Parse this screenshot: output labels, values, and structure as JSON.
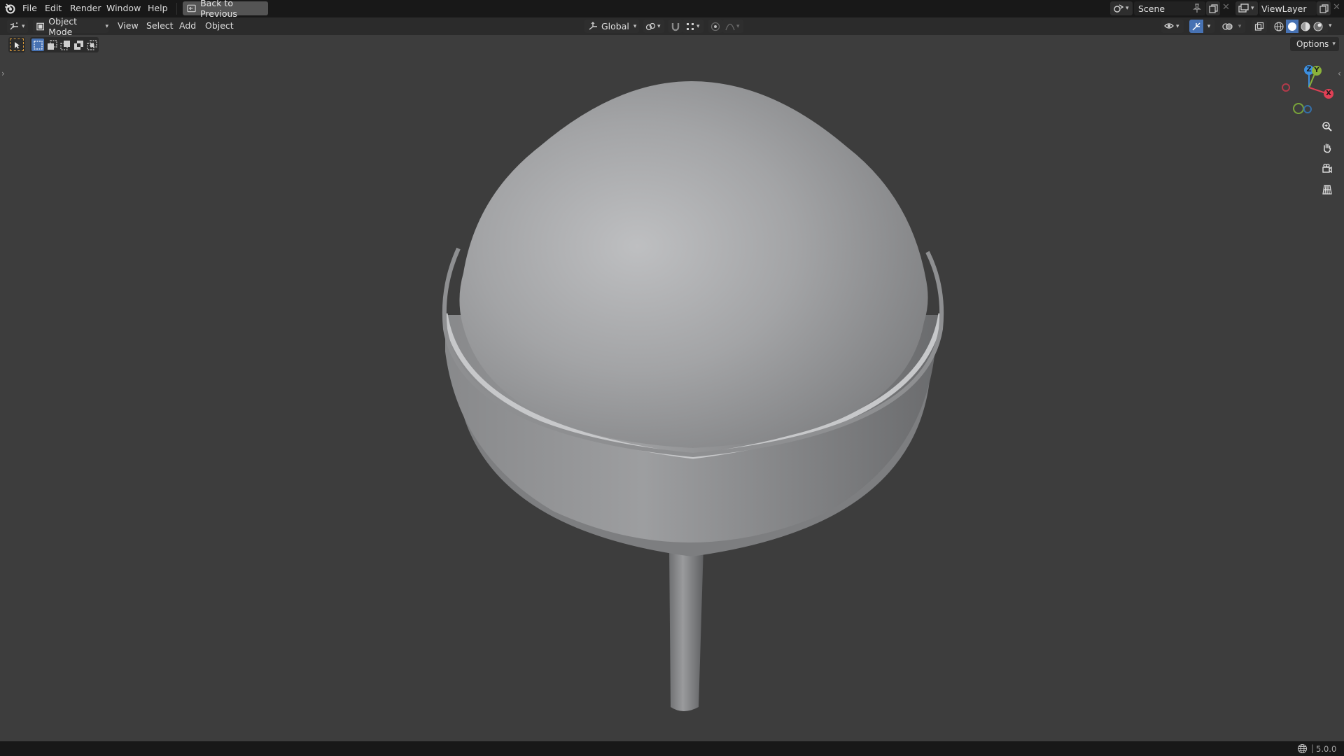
{
  "menu": {
    "file": "File",
    "edit": "Edit",
    "render": "Render",
    "window": "Window",
    "help": "Help",
    "back_to_previous": "Back to Previous"
  },
  "scene": {
    "name": "Scene"
  },
  "view_layer": {
    "name": "ViewLayer"
  },
  "header": {
    "mode": "Object Mode",
    "view": "View",
    "select": "Select",
    "add": "Add",
    "object": "Object",
    "orientation": "Global"
  },
  "options": {
    "label": "Options"
  },
  "gizmo": {
    "z": "Z",
    "y": "Y",
    "x": "X"
  },
  "status": {
    "version": "5.0.0"
  },
  "colors": {
    "accent_blue": "#4772b3",
    "axis_x": "#e04055",
    "axis_y": "#8ab23a",
    "axis_z": "#3d8fe0"
  }
}
